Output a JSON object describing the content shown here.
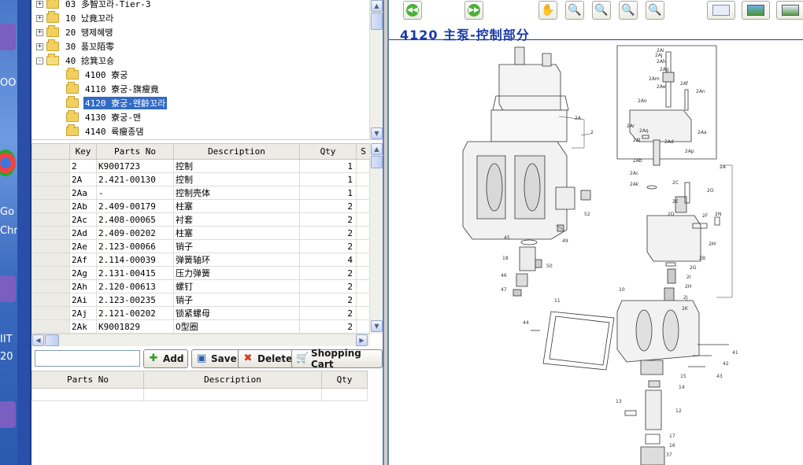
{
  "desktop": {
    "texts": [
      "OO",
      "Go",
      "Chr",
      "IIT",
      "20"
    ]
  },
  "tree": {
    "items": [
      {
        "label": "03 多智꼬라-Tier-3",
        "expander": "+",
        "open": false
      },
      {
        "label": "10 났竟꼬라",
        "expander": "+",
        "open": false
      },
      {
        "label": "20 땡제혜땡",
        "expander": "+",
        "open": false
      },
      {
        "label": "30 품꼬陌零",
        "expander": "+",
        "open": false
      },
      {
        "label": "40 捻箕꼬숑",
        "expander": "-",
        "open": true
      },
      {
        "label": "4100 寮궁",
        "expander": "",
        "open": false
      },
      {
        "label": "4110 寮궁-旗瘦竟",
        "expander": "",
        "open": false
      },
      {
        "label": "4120 寮궁-왠齡꼬라",
        "expander": "",
        "open": false,
        "selected": true
      },
      {
        "label": "4130 寮궁-맨",
        "expander": "",
        "open": false
      },
      {
        "label": "4140 륙瘦종댐",
        "expander": "",
        "open": false
      }
    ]
  },
  "parts_table": {
    "columns": [
      "",
      "Key",
      "Parts No",
      "Description",
      "Qty",
      "S"
    ],
    "rows": [
      {
        "key": "2",
        "parts_no": "K9001723",
        "desc": "控制",
        "qty": "1"
      },
      {
        "key": "2A",
        "parts_no": "2.421-00130",
        "desc": "控制",
        "qty": "1"
      },
      {
        "key": "2Aa",
        "parts_no": "-",
        "desc": "控制壳体",
        "qty": "1"
      },
      {
        "key": "2Ab",
        "parts_no": "2.409-00179",
        "desc": "柱塞",
        "qty": "2"
      },
      {
        "key": "2Ac",
        "parts_no": "2.408-00065",
        "desc": "衬套",
        "qty": "2"
      },
      {
        "key": "2Ad",
        "parts_no": "2.409-00202",
        "desc": "柱塞",
        "qty": "2"
      },
      {
        "key": "2Ae",
        "parts_no": "2.123-00066",
        "desc": "销子",
        "qty": "2"
      },
      {
        "key": "2Af",
        "parts_no": "2.114-00039",
        "desc": "弹簧轴环",
        "qty": "4"
      },
      {
        "key": "2Ag",
        "parts_no": "2.131-00415",
        "desc": "压力弹簧",
        "qty": "2"
      },
      {
        "key": "2Ah",
        "parts_no": "2.120-00613",
        "desc": "螺钉",
        "qty": "2"
      },
      {
        "key": "2Ai",
        "parts_no": "2.123-00235",
        "desc": "销子",
        "qty": "2"
      },
      {
        "key": "2Aj",
        "parts_no": "2.121-00202",
        "desc": "锁紧螺母",
        "qty": "2"
      },
      {
        "key": "2Ak",
        "parts_no": "K9001829",
        "desc": "O型圈",
        "qty": "2"
      }
    ]
  },
  "actions": {
    "input_value": "",
    "add": "Add",
    "save": "Save",
    "delete": "Delete",
    "cart": "Shopping Cart"
  },
  "cart_table": {
    "columns": [
      "Parts No",
      "Description",
      "Qty"
    ]
  },
  "viewer": {
    "title": "4120 主泵-控制部分",
    "labels": {
      "l2": "2",
      "l2A": "2A",
      "l2Aa": "2Aa",
      "l2Ab": "2Ab",
      "l2Ac": "2Ac",
      "l2Ad": "2Ad",
      "l2Ae": "2Ae",
      "l2Af": "2Af",
      "l2Ag": "2Ag",
      "l2Ah": "2Ah",
      "l2Ai": "2Ai",
      "l2Aj": "2Aj",
      "l2Ak": "2Ak",
      "l2Al": "2Al",
      "l2Am": "2Am",
      "l2An": "2An",
      "l2Ao": "2Ao",
      "l2Ap": "2Ap",
      "l2Aq": "2Aq",
      "l2Ar": "2Ar",
      "l2B": "2B",
      "l2C": "2C",
      "l2D": "2D",
      "l2E": "2E",
      "l2F": "2F",
      "l2G": "2G",
      "l2H": "2H",
      "l2I": "2I",
      "l2J": "2J",
      "l2K": "2K",
      "l2M": "2M",
      "l2N": "2N",
      "l2O": "2O",
      "l10": "10",
      "l11": "11",
      "l12": "12",
      "l13": "13",
      "l14": "14",
      "l15": "15",
      "l16": "16",
      "l17": "17",
      "l18": "18",
      "l37": "37",
      "l41": "41",
      "l42": "42",
      "l43": "43",
      "l44": "44",
      "l45": "45",
      "l46": "46",
      "l47": "47",
      "l49": "49",
      "l50": "50",
      "l52": "52"
    }
  }
}
